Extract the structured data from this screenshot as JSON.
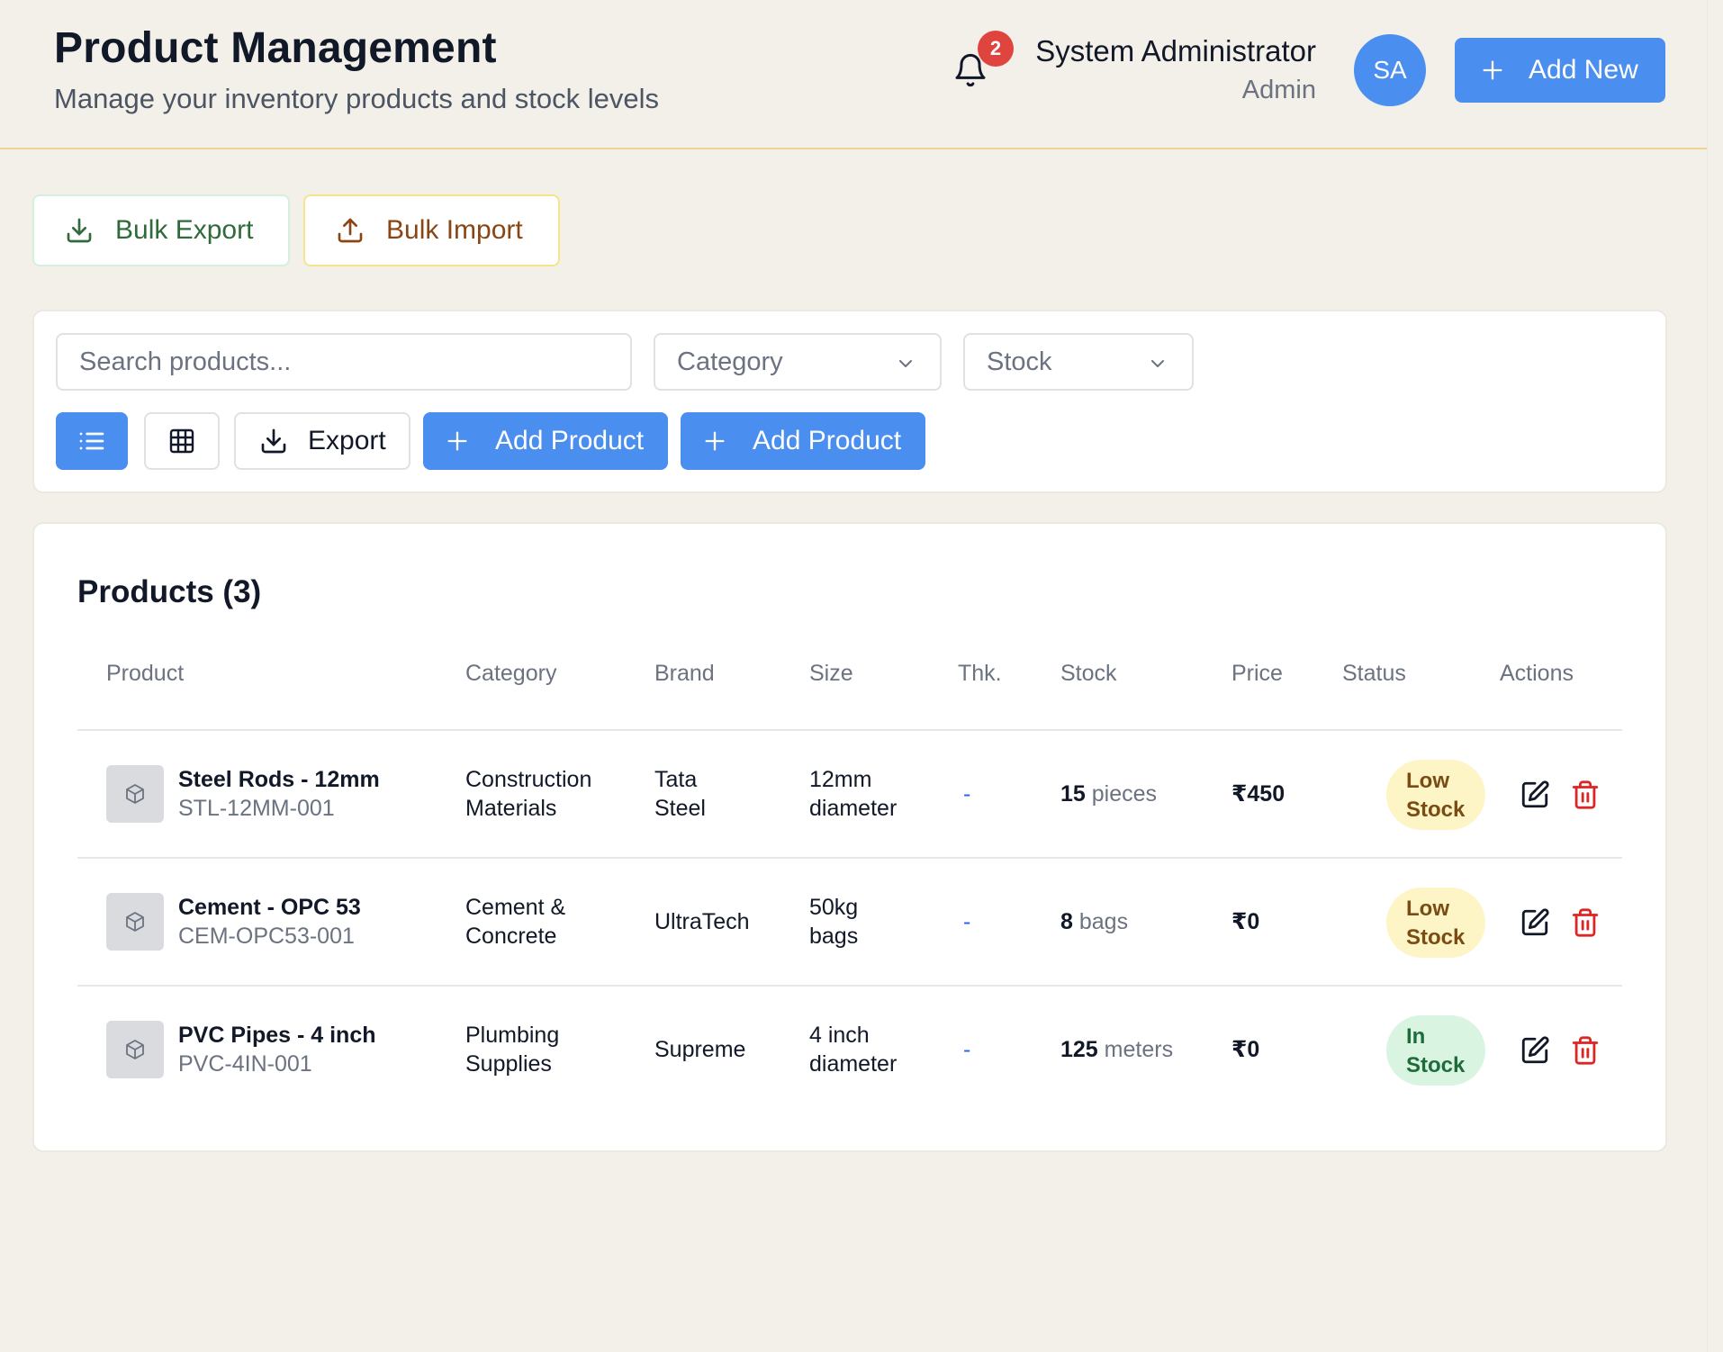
{
  "header": {
    "title": "Product Management",
    "subtitle": "Manage your inventory products and stock levels",
    "notification_count": "2",
    "user_name": "System Administrator",
    "user_role": "Admin",
    "avatar_initials": "SA",
    "add_new_label": "Add New"
  },
  "bulk": {
    "export_label": "Bulk Export",
    "import_label": "Bulk Import"
  },
  "filters": {
    "search_placeholder": "Search products...",
    "category_label": "Category",
    "stock_label": "Stock",
    "export_label": "Export",
    "add_product_label_1": "Add Product",
    "add_product_label_2": "Add Product"
  },
  "products": {
    "title": "Products (3)",
    "columns": [
      "Product",
      "Category",
      "Brand",
      "Size",
      "Thk.",
      "Stock",
      "Price",
      "Status",
      "Actions"
    ],
    "rows": [
      {
        "name": "Steel Rods - 12mm",
        "sku": "STL-12MM-001",
        "category_l1": "Construction",
        "category_l2": "Materials",
        "brand_l1": "Tata",
        "brand_l2": "Steel",
        "size_l1": "12mm",
        "size_l2": "diameter",
        "thickness": "-",
        "stock_qty": "15",
        "stock_unit": "pieces",
        "price": "₹450",
        "status_l1": "Low",
        "status_l2": "Stock",
        "status_type": "low"
      },
      {
        "name": "Cement - OPC 53",
        "sku": "CEM-OPC53-001",
        "category_l1": "Cement &",
        "category_l2": "Concrete",
        "brand_l1": "UltraTech",
        "brand_l2": "",
        "size_l1": "50kg",
        "size_l2": "bags",
        "thickness": "-",
        "stock_qty": "8",
        "stock_unit": "bags",
        "price": "₹0",
        "status_l1": "Low",
        "status_l2": "Stock",
        "status_type": "low"
      },
      {
        "name": "PVC Pipes - 4 inch",
        "sku": "PVC-4IN-001",
        "category_l1": "Plumbing",
        "category_l2": "Supplies",
        "brand_l1": "Supreme",
        "brand_l2": "",
        "size_l1": "4 inch",
        "size_l2": "diameter",
        "thickness": "-",
        "stock_qty": "125",
        "stock_unit": "meters",
        "price": "₹0",
        "status_l1": "In",
        "status_l2": "Stock",
        "status_type": "in"
      }
    ]
  },
  "colors": {
    "primary": "#4a8ef0",
    "background": "#f3efe9",
    "header_border": "#f2d491",
    "danger": "#dc2626",
    "low_stock_bg": "#fdf5c6",
    "in_stock_bg": "#d9f5e2"
  },
  "icons": {
    "bell": "bell-icon",
    "plus": "plus-icon",
    "download": "download-icon",
    "upload": "upload-icon",
    "chevron": "chevron-down-icon",
    "list": "list-icon",
    "grid": "grid-icon",
    "box": "box-icon",
    "edit": "edit-icon",
    "delete": "trash-icon"
  }
}
